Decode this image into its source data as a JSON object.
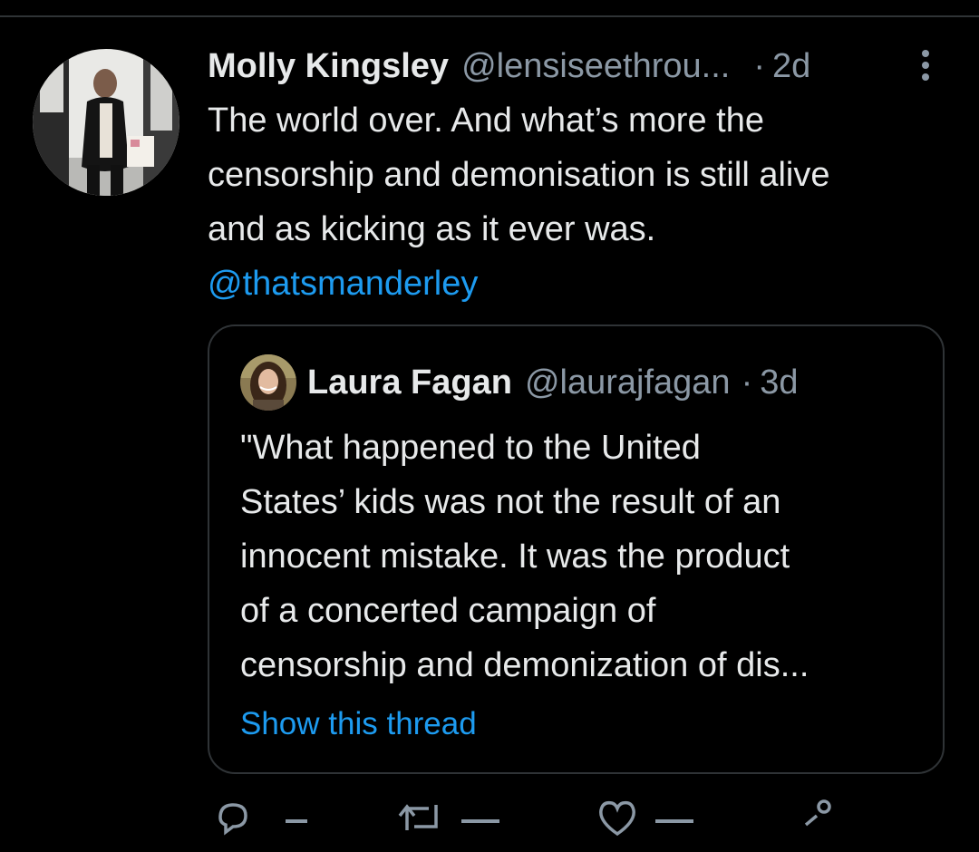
{
  "tweet": {
    "author_name": "Molly Kingsley",
    "author_handle": "@lensiseethrou...",
    "separator": "·",
    "time": "2d",
    "text_lines": [
      "The world over. And what’s more the",
      "censorship and demonisation is still alive",
      "and as kicking as it ever was."
    ],
    "mention": "@thatsmanderley"
  },
  "quoted_tweet": {
    "author_name": "Laura Fagan",
    "author_handle": "@laurajfagan",
    "separator": "·",
    "time": "3d",
    "text_lines": [
      "\"What happened to the United",
      "States’ kids was not the result of an",
      "innocent mistake. It was the product",
      "of a concerted campaign of",
      "censorship and demonization of dis..."
    ],
    "show_thread_label": "Show this thread"
  },
  "actions": {
    "reply_icon": "reply-icon",
    "retweet_icon": "retweet-icon",
    "like_icon": "heart-icon",
    "share_icon": "share-icon"
  },
  "colors": {
    "background": "#000000",
    "text": "#e7e9ea",
    "secondary": "#8b98a5",
    "link": "#1d9bf0",
    "border": "#2f3336"
  }
}
